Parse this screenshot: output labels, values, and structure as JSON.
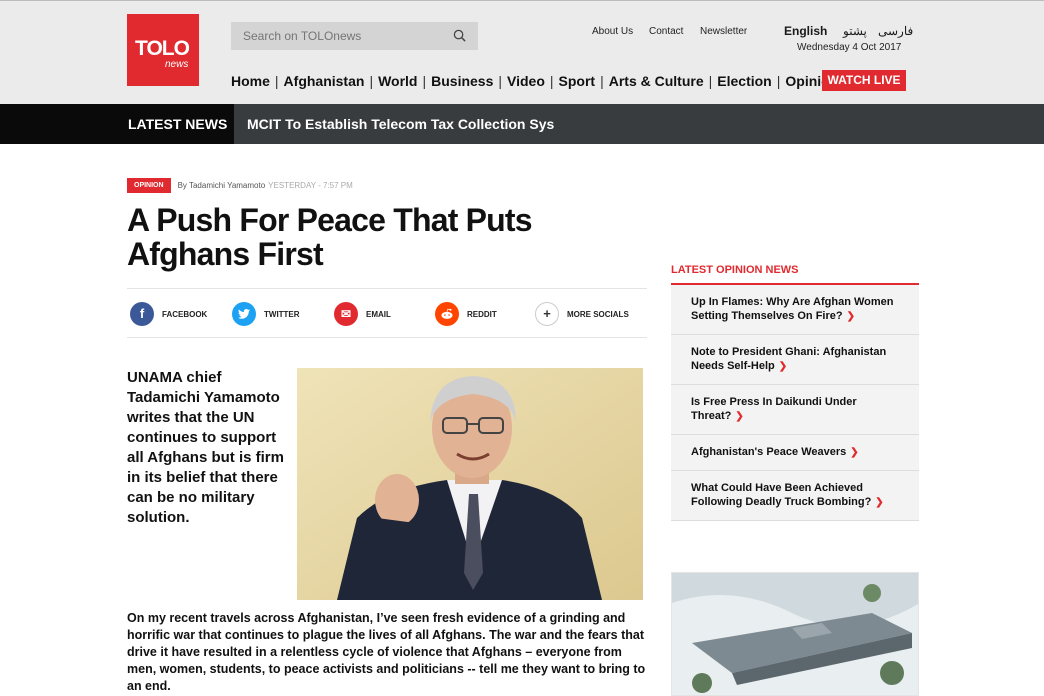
{
  "site": {
    "logo_main": "TOLO",
    "logo_sub": "news"
  },
  "search": {
    "placeholder": "Search on TOLOnews"
  },
  "top_links": [
    "About Us",
    "Contact",
    "Newsletter"
  ],
  "languages": [
    "English",
    "پشتو",
    "فارسی"
  ],
  "date": "Wednesday 4 Oct 2017",
  "nav": [
    "Home",
    "Afghanistan",
    "World",
    "Business",
    "Video",
    "Sport",
    "Arts & Culture",
    "Election",
    "Opinion"
  ],
  "watch_live": "WATCH LIVE",
  "ticker": {
    "label": "LATEST NEWS",
    "headline": "MCIT To Establish Telecom Tax Collection Sys"
  },
  "article": {
    "category": "OPINION",
    "author": "By Tadamichi Yamamoto",
    "time": "YESTERDAY - 7:57 PM",
    "title": "A Push For Peace That Puts Afghans First",
    "lead": "UNAMA chief Tadamichi Yamamoto writes that the UN continues to support all Afghans but is firm in its belief that there can be no military solution.",
    "body": "On my recent travels across Afghanistan, I’ve seen fresh evidence of a grinding and horrific war that continues to plague the lives of all Afghans. The war and the fears that drive it have resulted in a relentless cycle of violence that Afghans – everyone from men, women, students, to peace activists and politicians -- tell me they want to bring to an end."
  },
  "social": [
    {
      "label": "FACEBOOK",
      "icon": "facebook-icon",
      "color": "#3b5998",
      "glyph": "f"
    },
    {
      "label": "TWITTER",
      "icon": "twitter-icon",
      "color": "#1da1f2",
      "glyph": "t"
    },
    {
      "label": "EMAIL",
      "icon": "email-icon",
      "color": "#e02a2f",
      "glyph": "✉"
    },
    {
      "label": "REDDIT",
      "icon": "reddit-icon",
      "color": "#ff4500",
      "glyph": "r"
    },
    {
      "label": "MORE SOCIALS",
      "icon": "plus-icon",
      "color": "#ffffff",
      "glyph": "+"
    }
  ],
  "sidebar": {
    "heading": "LATEST OPINION NEWS",
    "items": [
      "Up In Flames: Why Are Afghan Women Setting Themselves On Fire?",
      "Note to President Ghani: Afghanistan Needs Self-Help",
      "Is Free Press In Daikundi Under Threat?",
      "Afghanistan's Peace Weavers",
      "What Could Have Been Achieved Following Deadly Truck Bombing?"
    ]
  },
  "colors": {
    "brand_red": "#e02a2f",
    "ticker_dark": "#383c3f"
  }
}
